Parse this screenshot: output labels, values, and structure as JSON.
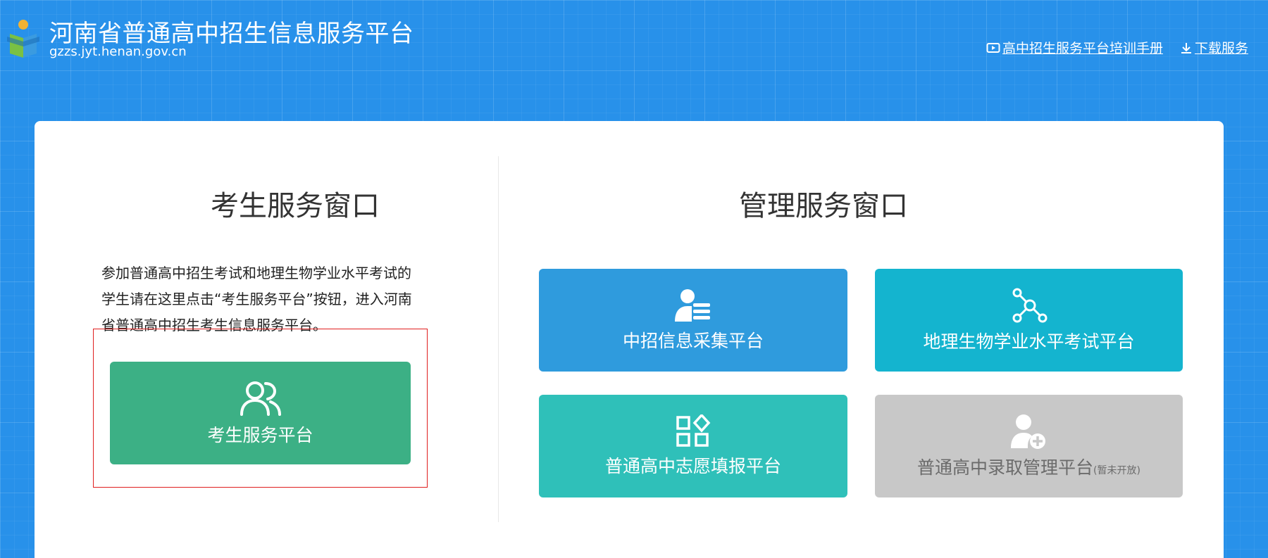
{
  "header": {
    "site_title": "河南省普通高中招生信息服务平台",
    "domain": "gzzs.jyt.henan.gov.cn",
    "links": {
      "manual": "高中招生服务平台培训手册",
      "download": "下载服务"
    }
  },
  "student_section": {
    "title": "考生服务窗口",
    "description": "参加普通高中招生考试和地理生物学业水平考试的学生请在这里点击“考生服务平台”按钮，进入河南省普通高中招生考生信息服务平台。",
    "button_label": "考生服务平台"
  },
  "admin_section": {
    "title": "管理服务窗口",
    "tiles": [
      {
        "label": "中招信息采集平台",
        "icon": "user-list-icon",
        "color": "#2f9bdd"
      },
      {
        "label": "地理生物学业水平考试平台",
        "icon": "network-nodes-icon",
        "color": "#14b4cf"
      },
      {
        "label": "普通高中志愿填报平台",
        "icon": "apps-grid-icon",
        "color": "#2fc0b9"
      },
      {
        "label": "普通高中录取管理平台",
        "note": "(暂未开放)",
        "icon": "user-add-icon",
        "color": "#c8c8c8"
      }
    ]
  },
  "colors": {
    "background": "#2891ea",
    "student_button": "#3cb085",
    "highlight_border": "#e01e1e"
  }
}
